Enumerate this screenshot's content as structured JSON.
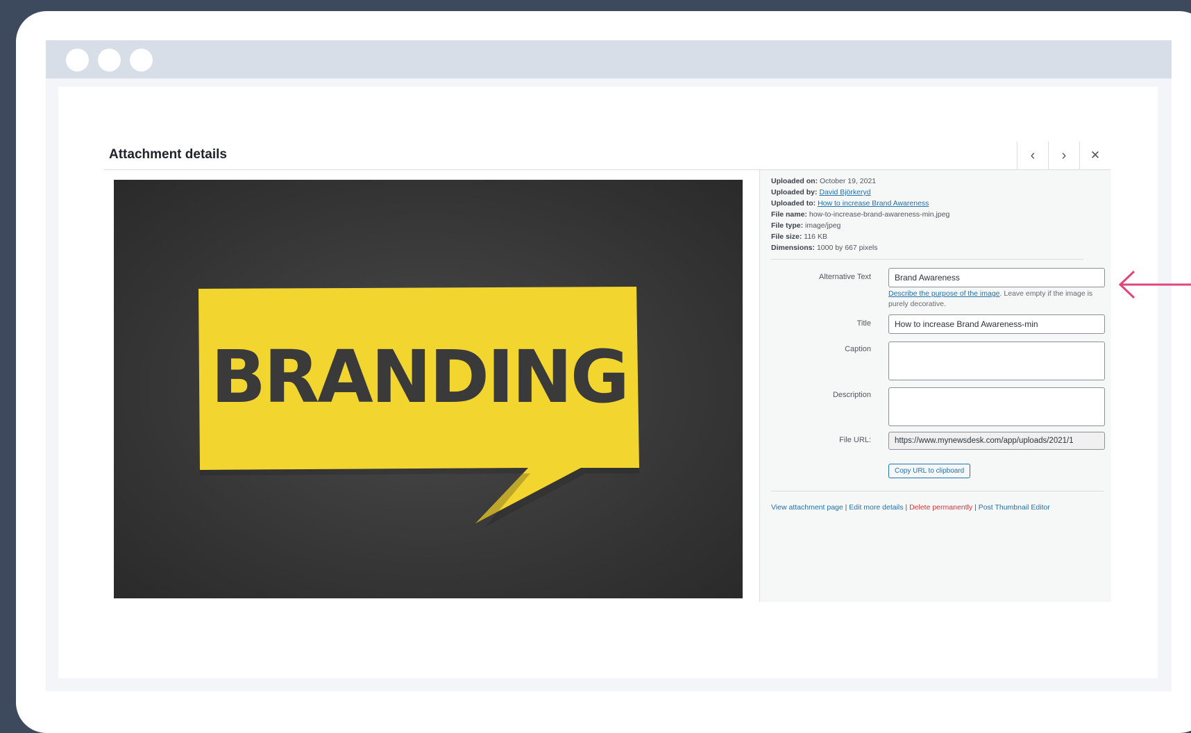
{
  "modal": {
    "title": "Attachment details",
    "prev_icon": "chevron-left-icon",
    "next_icon": "chevron-right-icon",
    "close_icon": "close-icon"
  },
  "image": {
    "word": "BRANDING",
    "background_color": "#3a3a3a",
    "bubble_color": "#f3d52f"
  },
  "meta": {
    "uploaded_on_label": "Uploaded on:",
    "uploaded_on": "October 19, 2021",
    "uploaded_by_label": "Uploaded by:",
    "uploaded_by": "David Björkeryd",
    "uploaded_to_label": "Uploaded to:",
    "uploaded_to": "How to increase Brand Awareness",
    "file_name_label": "File name:",
    "file_name": "how-to-increase-brand-awareness-min.jpeg",
    "file_type_label": "File type:",
    "file_type": "image/jpeg",
    "file_size_label": "File size:",
    "file_size": "116 KB",
    "dimensions_label": "Dimensions:",
    "dimensions": "1000 by 667 pixels"
  },
  "form": {
    "alt_label": "Alternative Text",
    "alt_value": "Brand Awareness",
    "alt_help_link": "Describe the purpose of the image",
    "alt_help_text": ". Leave empty if the image is purely decorative.",
    "title_label": "Title",
    "title_value": "How to increase Brand Awareness-min",
    "caption_label": "Caption",
    "caption_value": "",
    "description_label": "Description",
    "description_value": "",
    "file_url_label": "File URL:",
    "file_url_value": "https://www.mynewsdesk.com/app/uploads/2021/1",
    "copy_button": "Copy URL to clipboard"
  },
  "actions": {
    "view": "View attachment page",
    "edit": "Edit more details",
    "delete": "Delete permanently",
    "thumbnail": "Post Thumbnail Editor",
    "separator": "|"
  },
  "colors": {
    "page_bg": "#3d4a5e",
    "link": "#2271b1",
    "delete": "#d63638",
    "arrow": "#e0457b"
  }
}
